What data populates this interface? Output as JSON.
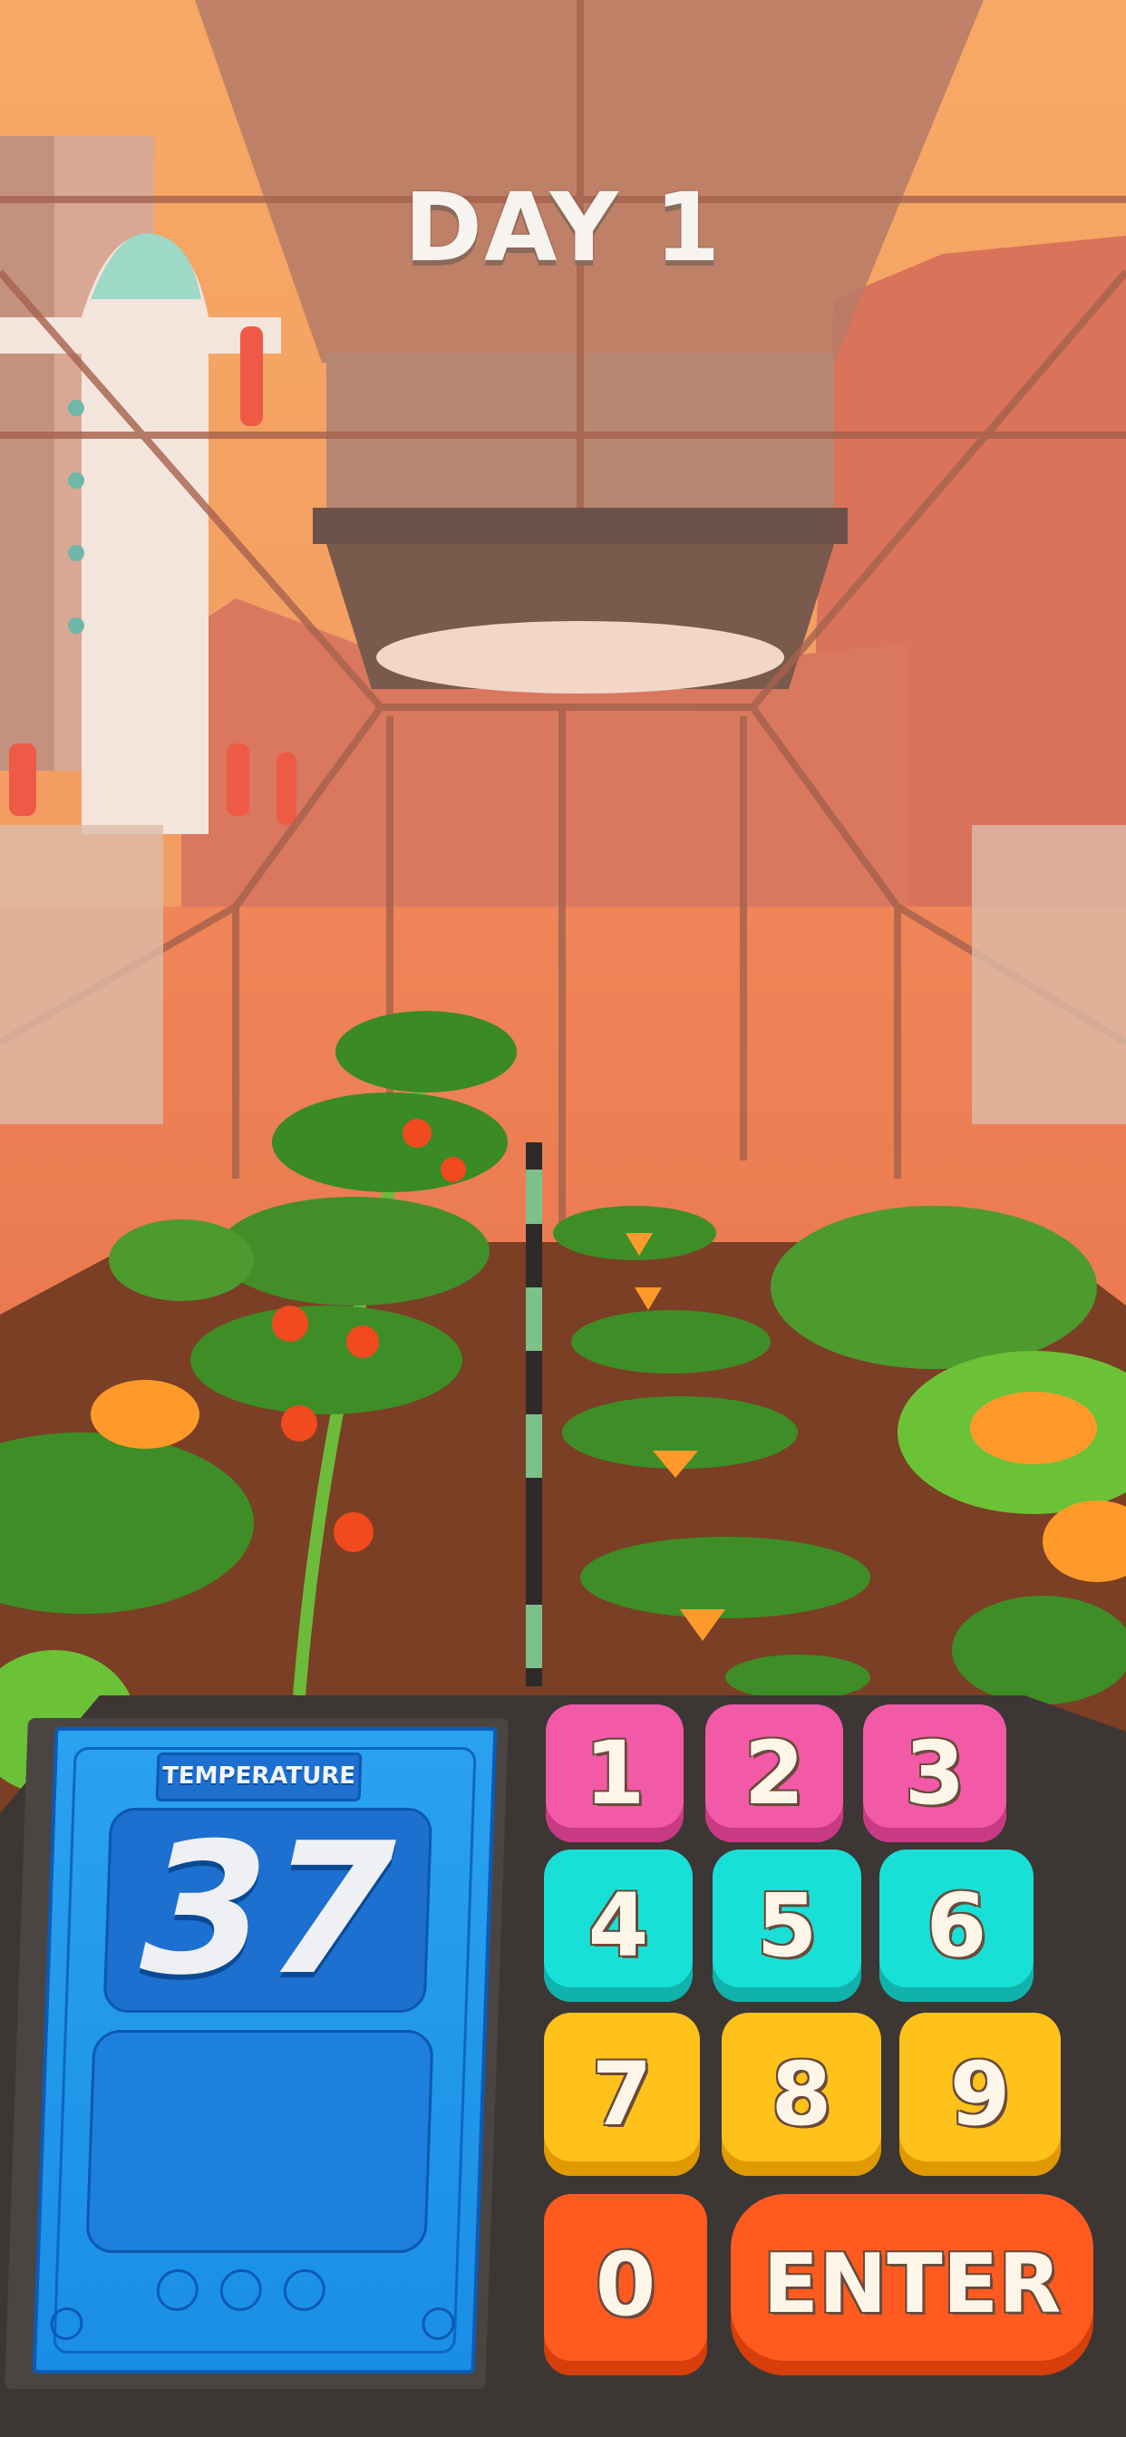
{
  "hud": {
    "day_label": "DAY 1"
  },
  "display": {
    "temperature_label": "TEMPERATURE",
    "temperature_value": "37",
    "input_value": ""
  },
  "keypad": {
    "keys": [
      "1",
      "2",
      "3",
      "4",
      "5",
      "6",
      "7",
      "8",
      "9",
      "0"
    ],
    "enter_label": "ENTER"
  },
  "colors": {
    "sky": "#f7b26a",
    "ground": "#e4774a",
    "soil": "#7a3f24",
    "screen_blue": "#1a8ee6",
    "key_pink": "#f25aa8",
    "key_teal": "#19e0d6",
    "key_yellow": "#ffc21a",
    "key_orange": "#ff5a1f"
  }
}
